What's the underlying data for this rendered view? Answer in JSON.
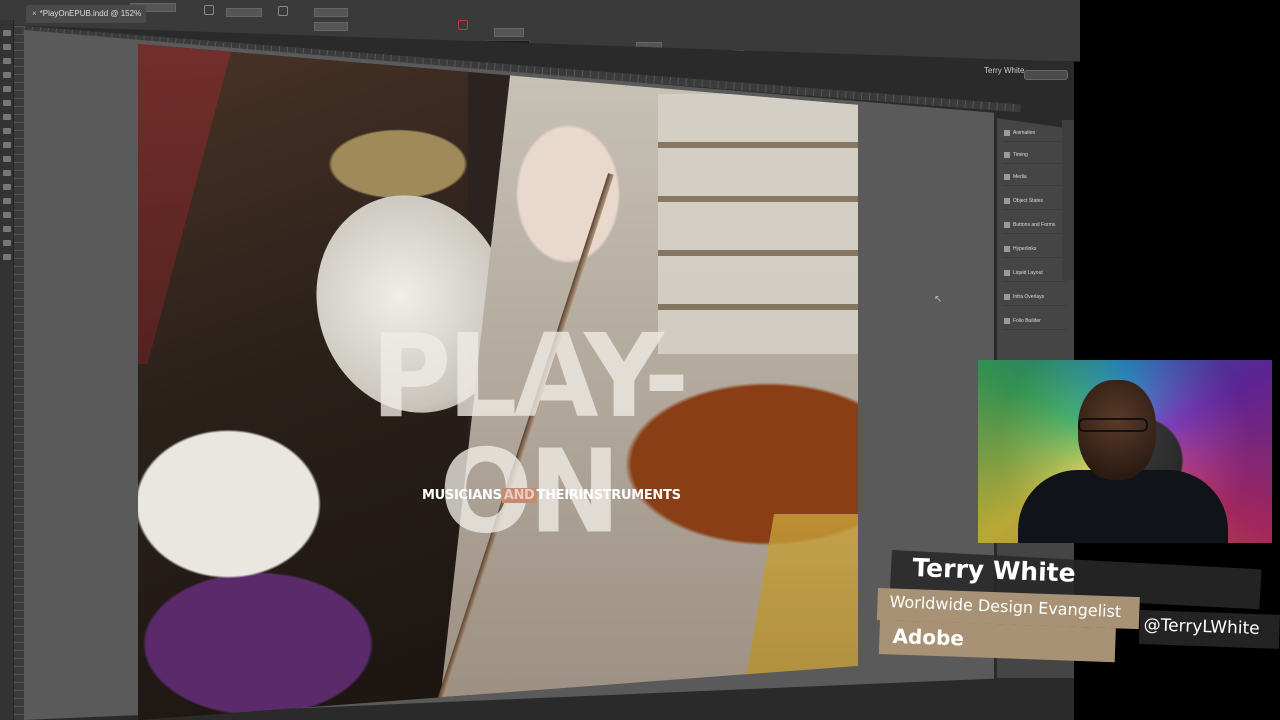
{
  "window": {
    "doc_tab": "*PlayOnEPUB.indd @ 152%",
    "doc_tab_close": "×",
    "user_name": "Terry White"
  },
  "panels": {
    "items": [
      {
        "label": "Animation",
        "icon": "animation-icon"
      },
      {
        "label": "Timing",
        "icon": "timing-icon"
      },
      {
        "label": "Media",
        "icon": "media-icon"
      },
      {
        "label": "Object States",
        "icon": "object-states-icon"
      },
      {
        "label": "Buttons and Forms",
        "icon": "buttons-forms-icon"
      },
      {
        "label": "Hyperlinks",
        "icon": "hyperlinks-icon"
      },
      {
        "label": "Liquid Layout",
        "icon": "liquid-layout-icon"
      },
      {
        "label": "Infra Overlays",
        "icon": "overlays-icon"
      },
      {
        "label": "Folio Builder",
        "icon": "folio-builder-icon"
      }
    ]
  },
  "artwork": {
    "headline": "PLAY-ON",
    "subtitle_a": "MUSICIANS",
    "subtitle_b": "AND",
    "subtitle_c": "THEIRINSTRUMENTS"
  },
  "lower_third": {
    "name": "Terry White",
    "title": "Worldwide Design Evangelist",
    "handle": "@TerryLWhite",
    "organization": "Adobe"
  },
  "colors": {
    "ui_dark": "#2a2a2a",
    "pasteboard": "#5a5a5a",
    "lower_third_tan": "#a89276",
    "subtitle_highlight": "#c88a6e"
  }
}
